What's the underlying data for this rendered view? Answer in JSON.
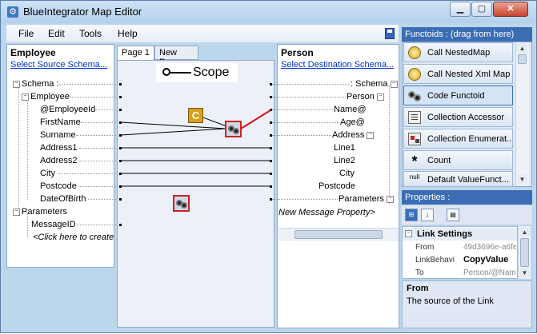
{
  "window": {
    "title": "BlueIntegrator Map Editor",
    "min_glyph": "▁",
    "max_glyph": "▢",
    "close_glyph": "✕"
  },
  "menu": {
    "file": "File",
    "edit": "Edit",
    "tools": "Tools",
    "help": "Help"
  },
  "source": {
    "header": "Employee",
    "select_link": "Select Source Schema...",
    "tree": [
      {
        "label": "Schema :",
        "expander": "−"
      },
      {
        "label": "Employee",
        "expander": "−"
      },
      {
        "label": "@EmployeeId"
      },
      {
        "label": "FirstName"
      },
      {
        "label": "Surname"
      },
      {
        "label": "Address1"
      },
      {
        "label": "Address2"
      },
      {
        "label": "City"
      },
      {
        "label": "Postcode"
      },
      {
        "label": "DateOfBirth"
      },
      {
        "label": "Parameters",
        "expander": "−"
      },
      {
        "label": "MessageID"
      },
      {
        "label": "<Click here to create"
      }
    ]
  },
  "canvas": {
    "tabs": [
      "Page 1",
      "New Page"
    ],
    "scope_label": "Scope",
    "functoid_c_letter": "C"
  },
  "destination": {
    "header": "Person",
    "select_link": "Select Destination Schema...",
    "tree": [
      {
        "label": ": Schema",
        "expander": "−"
      },
      {
        "label": "Person",
        "expander": "−"
      },
      {
        "label": "Name@"
      },
      {
        "label": "Age@"
      },
      {
        "label": "Address",
        "expander": "−"
      },
      {
        "label": "Line1"
      },
      {
        "label": "Line2"
      },
      {
        "label": "City"
      },
      {
        "label": "Postcode"
      },
      {
        "label": "Parameters",
        "expander": "−"
      },
      {
        "label": "New Message Property>"
      }
    ]
  },
  "functoids": {
    "header": "Functoids : (drag from here)",
    "items": [
      {
        "label": "Call NestedMap",
        "icon": "gold-orb-icon"
      },
      {
        "label": "Call Nested Xml Map",
        "icon": "gold-orb-icon"
      },
      {
        "label": "Code Functoid",
        "icon": "gears-icon",
        "selected": true
      },
      {
        "label": "Collection Accessor",
        "icon": "collection-icon"
      },
      {
        "label": "Collection Enumerat...",
        "icon": "enumerator-icon"
      },
      {
        "label": "Count",
        "icon": "asterisk-icon"
      },
      {
        "label": "Default ValueFunct...",
        "icon": "null-icon",
        "icon_text": "null"
      }
    ]
  },
  "properties": {
    "header": "Properties :",
    "section": "Link Settings",
    "section_expander": "−",
    "rows": [
      {
        "name": "From",
        "value": "49d3696e-a6fe"
      },
      {
        "name": "LinkBehavi",
        "value": "CopyValue"
      },
      {
        "name": "To",
        "value": "Person/@Nam"
      }
    ],
    "toolbar_glyphs": [
      "⊞",
      "↓",
      "▤"
    ]
  },
  "description": {
    "title": "From",
    "text": "The source of the Link"
  },
  "colors": {
    "accent": "#3c6db4",
    "link_red": "#dd1111",
    "functoid_c": "#d6a21c"
  }
}
